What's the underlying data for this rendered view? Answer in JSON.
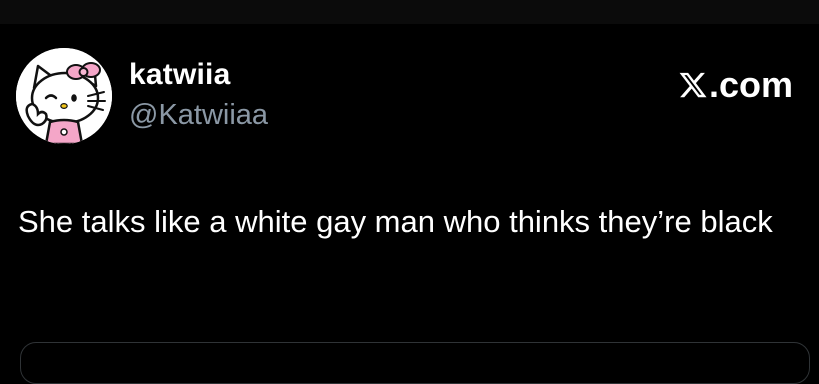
{
  "author": {
    "display_name": "katwiia",
    "handle": "@Katwiiaa",
    "avatar_icon": "hello-kitty-avatar-icon"
  },
  "brand": {
    "logo_icon": "x-logo-icon",
    "domain_text": ".com"
  },
  "tweet": {
    "text": "She talks like a white gay man who thinks they’re black"
  },
  "colors": {
    "background": "#000000",
    "primary_text": "#ffffff",
    "secondary_text": "#8b98a5",
    "border": "#2f3336"
  }
}
